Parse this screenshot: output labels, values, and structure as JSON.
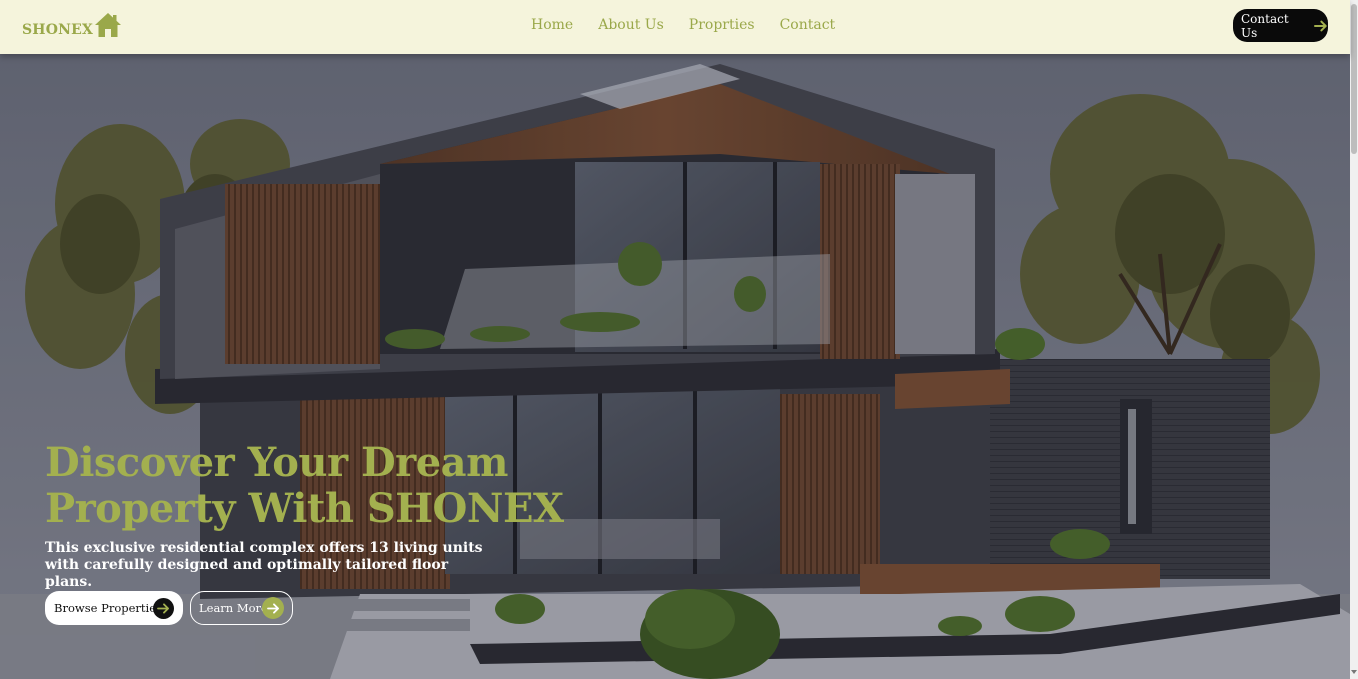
{
  "brand": {
    "name": "SHONEX",
    "icon": "house-icon",
    "color": "#9aa84a"
  },
  "nav": {
    "links": [
      {
        "label": "Home"
      },
      {
        "label": "About Us"
      },
      {
        "label": "Proprties"
      },
      {
        "label": "Contact"
      }
    ],
    "cta_label": "Contact Us",
    "cta_icon": "arrow-right-icon"
  },
  "hero": {
    "title_line1": "Discover Your Dream",
    "title_line2": "Property With SHONEX",
    "description": "This exclusive residential complex offers 13 living units with carefully designed and optimally tailored floor plans.",
    "browse_label": "Browse Properties",
    "learn_label": "Learn More",
    "accent_color": "#a3b04f",
    "image": "modern-house-illustration"
  }
}
